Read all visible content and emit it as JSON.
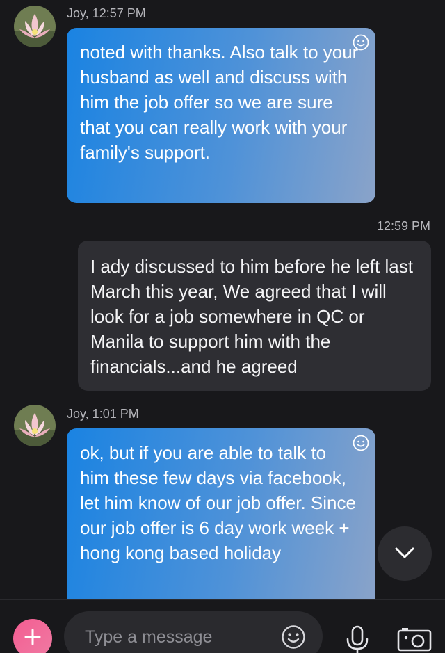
{
  "conversation": {
    "messages": [
      {
        "direction": "incoming",
        "sender": "Joy",
        "meta": "Joy, 12:57 PM",
        "text": "noted with thanks. Also talk to your husband as well and discuss with him the job offer so we are sure that you can really work with your family's support."
      },
      {
        "direction": "outgoing",
        "time": "12:59 PM",
        "text": "I ady discussed to him before he left last March this year, We agreed that I will look for a job somewhere in QC or Manila to support him with the financials...and he agreed"
      },
      {
        "direction": "incoming",
        "sender": "Joy",
        "meta": "Joy, 1:01 PM",
        "text": "ok, but if you are able to talk to him these few days via facebook, let him know of our job offer. Since our job offer is 6 day work week + hong kong based holiday"
      }
    ]
  },
  "composer": {
    "placeholder": "Type a message"
  },
  "icons": {
    "reaction": "smiley-icon",
    "scroll": "chevron-down-icon",
    "add": "plus-icon",
    "emoji": "emoji-icon",
    "voice": "microphone-icon",
    "media": "camera-icon",
    "avatar": "lotus-avatar"
  },
  "colors": {
    "background": "#18181b",
    "incoming_bubble_start": "#1a83e2",
    "incoming_bubble_end": "#8aa3c9",
    "outgoing_bubble": "#2e2e33",
    "add_button": "#f45d92"
  }
}
